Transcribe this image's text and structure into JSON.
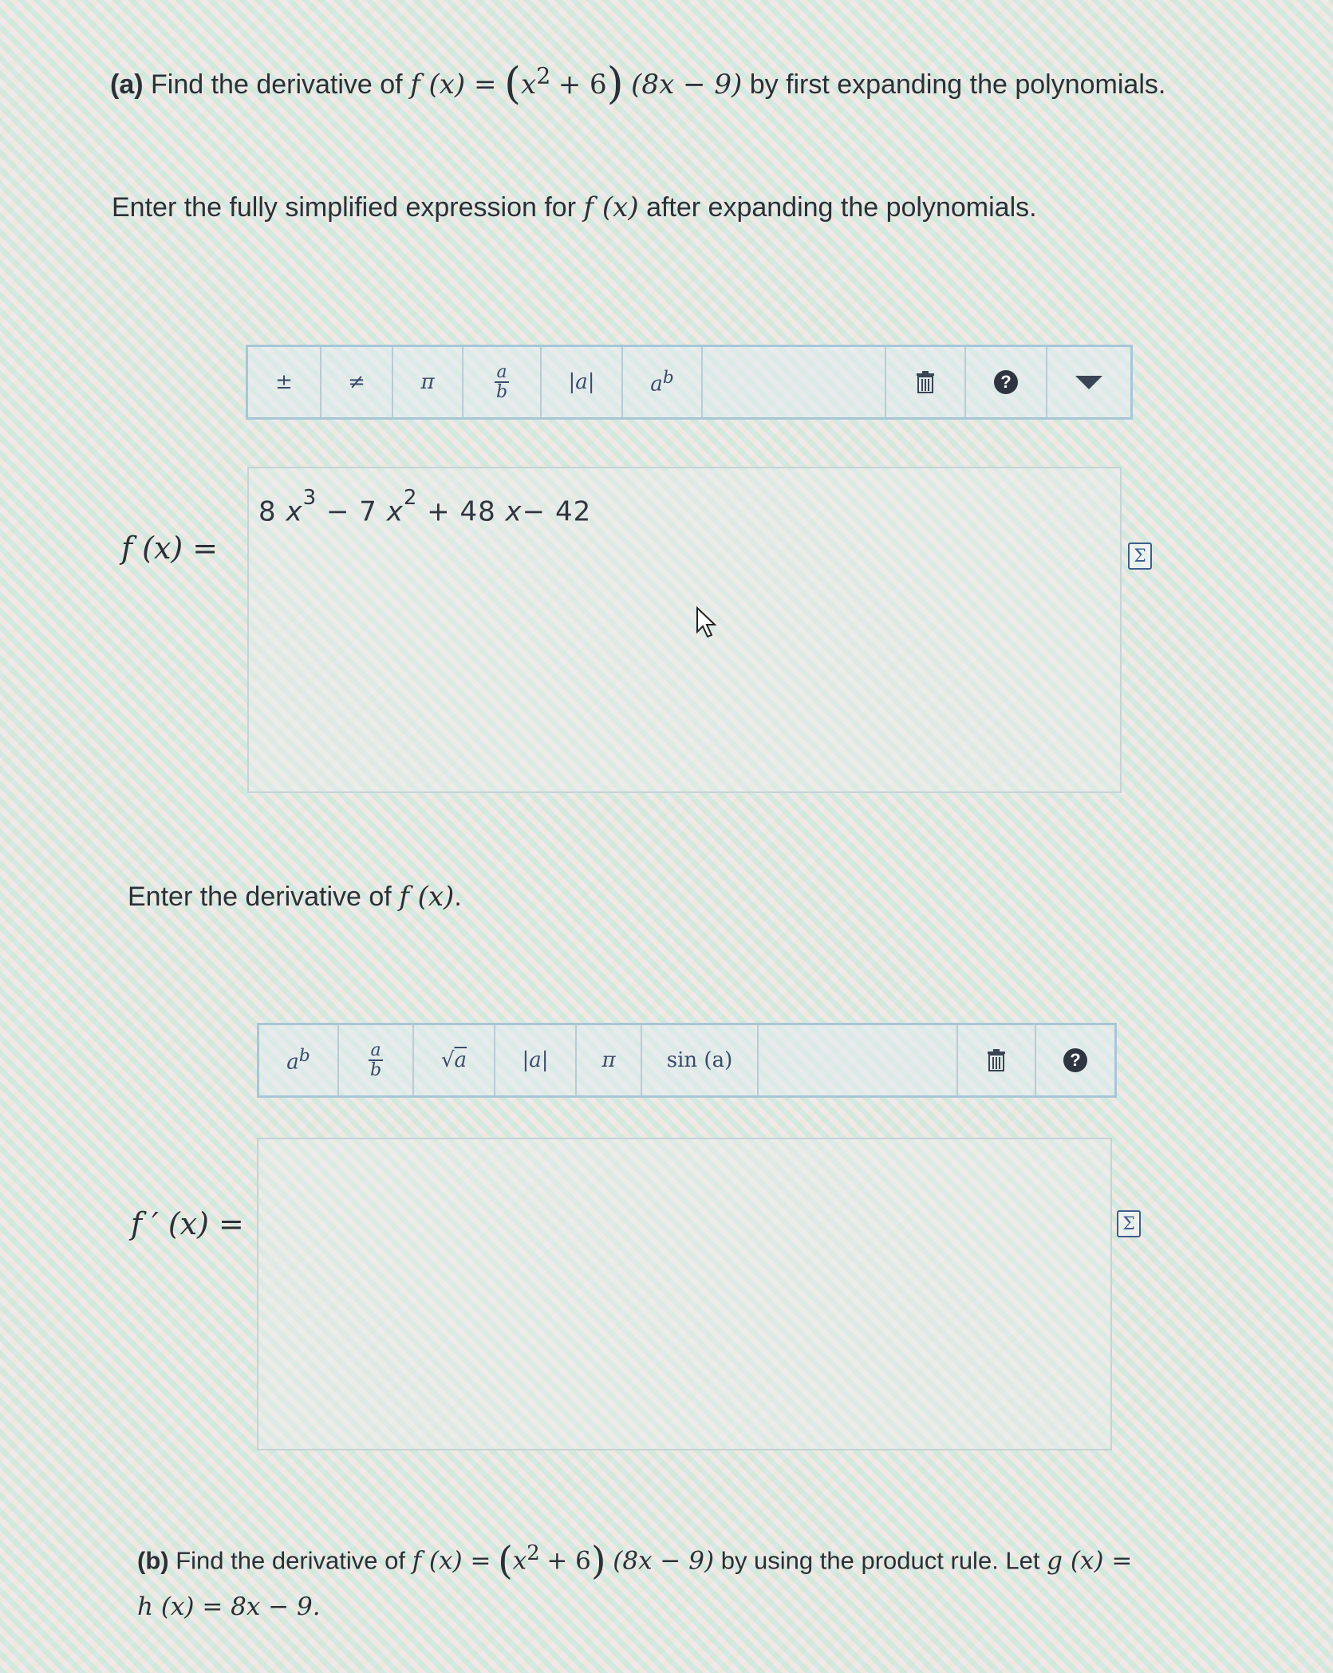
{
  "part_a": {
    "label": "(a)",
    "text_before": "Find the derivative of",
    "func_lhs": "f (x) =",
    "factor1": "x",
    "factor1_exp": "2",
    "factor1_tail": "+ 6",
    "factor2": "(8x − 9)",
    "text_after": "by first expanding the polynomials."
  },
  "prompt_expand": {
    "text_before": "Enter the fully simplified expression for",
    "func": "f (x)",
    "text_after": "after expanding the polynomials."
  },
  "toolbar1": {
    "buttons": [
      "±",
      "≠",
      "π",
      "a",
      "b",
      "|a|",
      "a",
      "b"
    ],
    "icons": [
      "plus-minus-icon",
      "not-equal-icon",
      "pi-icon",
      "fraction-icon",
      "absolute-value-icon",
      "power-icon",
      "trash-icon",
      "help-icon",
      "dropdown-arrow-icon"
    ],
    "help_symbol": "?"
  },
  "answer1": {
    "label": "f (x) =",
    "term1_coef": "8",
    "term1_exp": "3",
    "term2_coef": "− 7",
    "term2_exp": "2",
    "rest": "+ 48",
    "tail": "− 42",
    "var": "x",
    "sigma": "Σ"
  },
  "prompt_deriv": {
    "text_before": "Enter the derivative of",
    "func": "f (x)",
    "text_after": "."
  },
  "toolbar2": {
    "sqrt_arg": "a",
    "sin": "sin (a)",
    "help_symbol": "?"
  },
  "answer2": {
    "label": "f ′ (x) =",
    "sigma": "Σ"
  },
  "part_b": {
    "label": "(b)",
    "text_before": "Find the derivative of",
    "func_lhs": "f (x) =",
    "factor1": "x",
    "factor1_exp": "2",
    "factor1_tail": "+ 6",
    "factor2": "(8x − 9)",
    "text_after": "by using the product rule. Let",
    "g_def": "g (x) =",
    "line2": "h (x) = 8x − 9."
  }
}
